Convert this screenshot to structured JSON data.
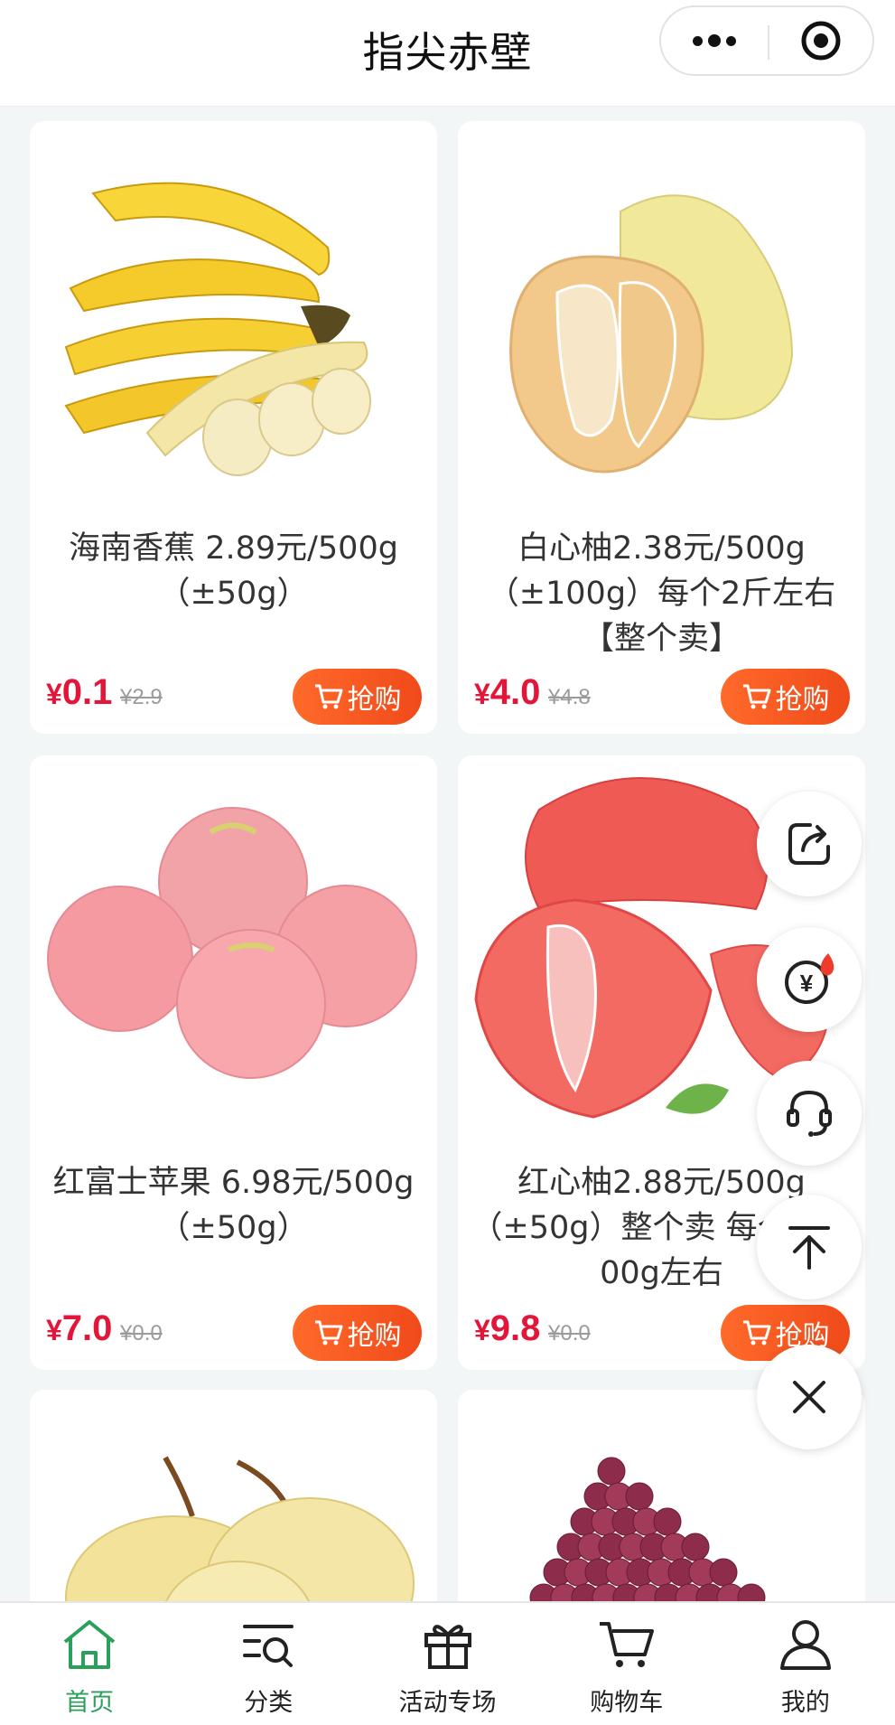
{
  "header": {
    "title": "指尖赤壁"
  },
  "products": [
    {
      "name": "海南香蕉 2.89元/500g（±50g）",
      "price": "0.1",
      "currency": "¥",
      "original_price": "¥2.9",
      "buy_label": "抢购",
      "image": "banana"
    },
    {
      "name": "白心柚2.38元/500g（±100g）每个2斤左右 【整个卖】",
      "price": "4.0",
      "currency": "¥",
      "original_price": "¥4.8",
      "buy_label": "抢购",
      "image": "white-pomelo"
    },
    {
      "name": "红富士苹果 6.98元/500g（±50g）",
      "price": "7.0",
      "currency": "¥",
      "original_price": "¥0.0",
      "buy_label": "抢购",
      "image": "apples"
    },
    {
      "name": "红心柚2.88元/500g（±50g）整个卖 每个柚子 00g左右",
      "price": "9.8",
      "currency": "¥",
      "original_price": "¥0.0",
      "buy_label": "抢购",
      "image": "red-pomelo"
    },
    {
      "image": "pears"
    },
    {
      "image": "grapes"
    }
  ],
  "floating_actions": [
    "share-icon",
    "yen-coin-icon",
    "customer-service-icon",
    "back-to-top-icon",
    "close-icon"
  ],
  "tabbar": {
    "items": [
      {
        "label": "首页",
        "icon": "home-icon",
        "active": true
      },
      {
        "label": "分类",
        "icon": "category-search-icon",
        "active": false
      },
      {
        "label": "活动专场",
        "icon": "gift-icon",
        "active": false
      },
      {
        "label": "购物车",
        "icon": "cart-icon",
        "active": false
      },
      {
        "label": "我的",
        "icon": "user-icon",
        "active": false
      }
    ]
  },
  "colors": {
    "price": "#e3163a",
    "buy_button": "#f25a22",
    "active_tab": "#2aa05a"
  }
}
